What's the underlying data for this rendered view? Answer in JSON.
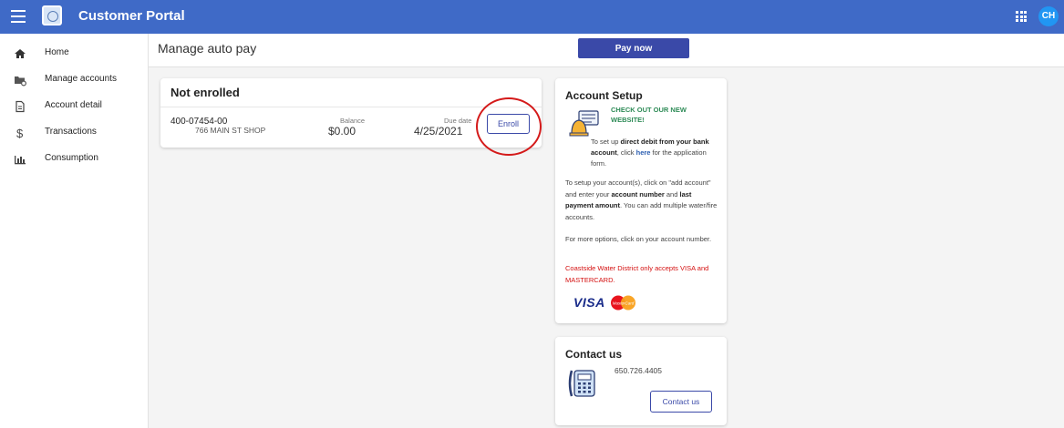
{
  "app": {
    "title": "Customer Portal",
    "user_initials": "CH"
  },
  "sidebar": {
    "items": [
      {
        "label": "Home",
        "icon": "home-icon"
      },
      {
        "label": "Manage accounts",
        "icon": "folder-gear-icon"
      },
      {
        "label": "Account detail",
        "icon": "document-icon"
      },
      {
        "label": "Transactions",
        "icon": "dollar-icon"
      },
      {
        "label": "Consumption",
        "icon": "bar-chart-icon"
      }
    ]
  },
  "page": {
    "title": "Manage auto pay",
    "pay_now_label": "Pay now"
  },
  "enrollment": {
    "header": "Not enrolled",
    "account_number": "400-07454-00",
    "address": "766 MAIN ST SHOP",
    "balance_label": "Balance",
    "balance_value": "$0.00",
    "due_label": "Due date",
    "due_value": "4/25/2021",
    "enroll_label": "Enroll"
  },
  "setup": {
    "title": "Account Setup",
    "new_site": "CHECK OUT OUR NEW WEBSITE!",
    "dd_1": "To set up ",
    "dd_bold": "direct debit from your bank account",
    "dd_2": ", click ",
    "dd_link": "here",
    "dd_3": " for the application form.",
    "s_1": "To setup your account(s), click on \"add account\" and enter your ",
    "s_b1": "account number",
    "s_2": " and ",
    "s_b2": "last payment amount",
    "s_3": ".  You can add multiple water/fire accounts.",
    "more": "For more options, click on your account number.",
    "notice": "Coastside Water District only accepts VISA and MASTERCARD.",
    "visa": "VISA",
    "mastercard": "MasterCard"
  },
  "contact": {
    "title": "Contact us",
    "phone": "650.726.4405",
    "button_label": "Contact us"
  },
  "colors": {
    "topbar": "#3f6ac7",
    "primary": "#3a49a8",
    "avatar": "#2196f3",
    "notice": "#d40f0f",
    "highlight": "#2e8b57"
  }
}
